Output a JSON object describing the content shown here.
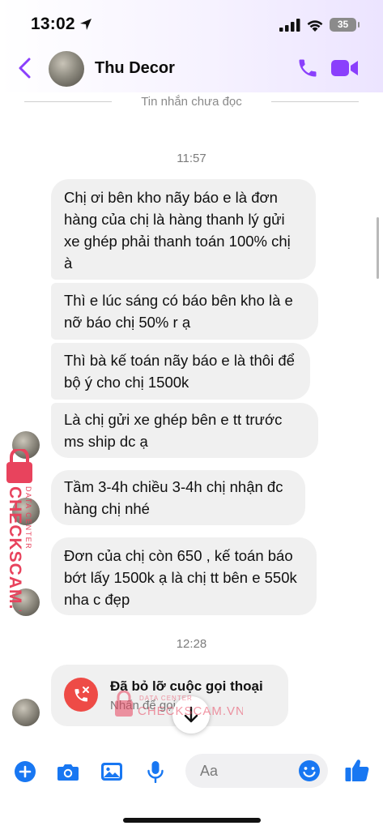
{
  "status_bar": {
    "time": "13:02",
    "battery": "35"
  },
  "header": {
    "contact_name": "Thu Decor"
  },
  "chat": {
    "unread_divider": "Tin nhắn chưa đọc",
    "timestamps": [
      "11:57",
      "12:28"
    ],
    "messages": [
      "Chị ơi bên kho nãy báo e  là đơn hàng của chị là hàng thanh lý gửi xe ghép phải thanh toán 100% chị à",
      "Thì e lúc sáng có báo bên kho là e nỡ báo chị 50% r ạ",
      "Thì bà kế toán nãy báo e là thôi để bộ ý cho chị 1500k",
      "Là chị gửi xe ghép bên e tt trước ms ship dc ạ",
      "Tầm 3-4h chiều 3-4h chị nhận đc hàng chị nhé",
      "Đơn của chị còn 650 , kế toán báo bớt lấy 1500k ạ là chị tt bên e 550k nha c đẹp"
    ],
    "missed_call": {
      "title": "Đã bỏ lỡ cuộc gọi thoại",
      "subtitle": "Nhấn để gọi lại"
    }
  },
  "watermark": {
    "brand": "CHECKSCAM.VN",
    "tagline": "DATA CENTER"
  },
  "composer": {
    "placeholder": "Aa"
  },
  "colors": {
    "accent": "#8a3ffc",
    "composer_blue": "#1877f2",
    "missed_call_red": "#ee4b46",
    "bubble": "#f0f0f0"
  },
  "icons": [
    "back-icon",
    "phone-icon",
    "video-icon",
    "plus-icon",
    "camera-icon",
    "image-icon",
    "mic-icon",
    "emoji-icon",
    "like-icon",
    "arrow-down-icon",
    "missed-call-icon"
  ]
}
